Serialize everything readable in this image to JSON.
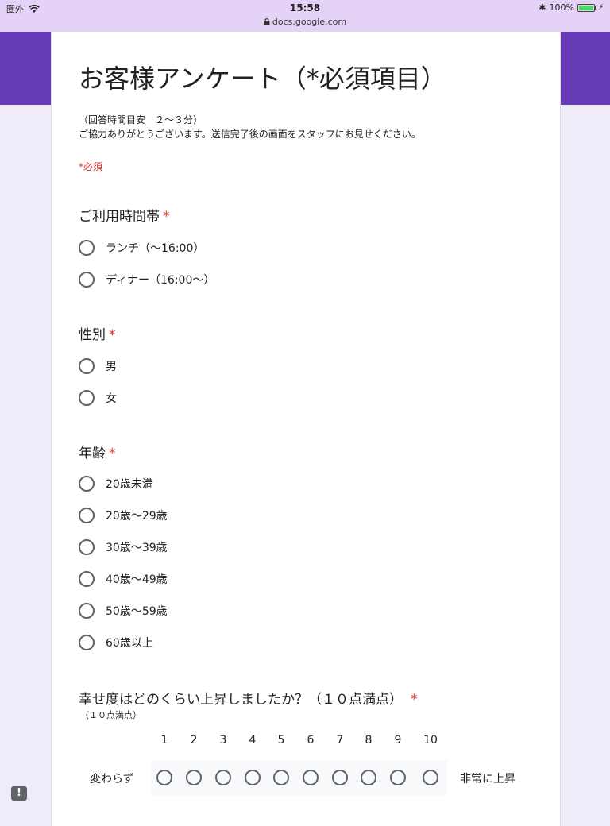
{
  "status_bar": {
    "carrier": "圏外",
    "time": "15:58",
    "url": "docs.google.com",
    "battery": "100%",
    "battery_level": 1.0
  },
  "colors": {
    "header": "#673ab7",
    "background": "#f0ebf8",
    "required": "#d93025"
  },
  "form": {
    "title": "お客様アンケート（*必須項目）",
    "description_line1": "（回答時間目安　２〜３分）",
    "description_line2": "ご協力ありがとうございます。送信完了後の画面をスタッフにお見せください。",
    "required_note": "*必須"
  },
  "questions": {
    "time_slot": {
      "title": "ご利用時間帯",
      "star": "*",
      "options": [
        "ランチ（〜16:00）",
        "ディナー（16:00〜）"
      ]
    },
    "gender": {
      "title": "性別",
      "star": "*",
      "options": [
        "男",
        "女"
      ]
    },
    "age": {
      "title": "年齢",
      "star": "*",
      "options": [
        "20歳未満",
        "20歳〜29歳",
        "30歳〜39歳",
        "40歳〜49歳",
        "50歳〜59歳",
        "60歳以上"
      ]
    },
    "happiness": {
      "title": "幸せ度はどのくらい上昇しましたか？（１０点満点）",
      "star": "*",
      "subtitle": "（１０点満点）",
      "scale": [
        "1",
        "2",
        "3",
        "4",
        "5",
        "6",
        "7",
        "8",
        "9",
        "10"
      ],
      "low_label": "変わらず",
      "high_label": "非常に上昇"
    }
  },
  "feedback_icon": "!"
}
